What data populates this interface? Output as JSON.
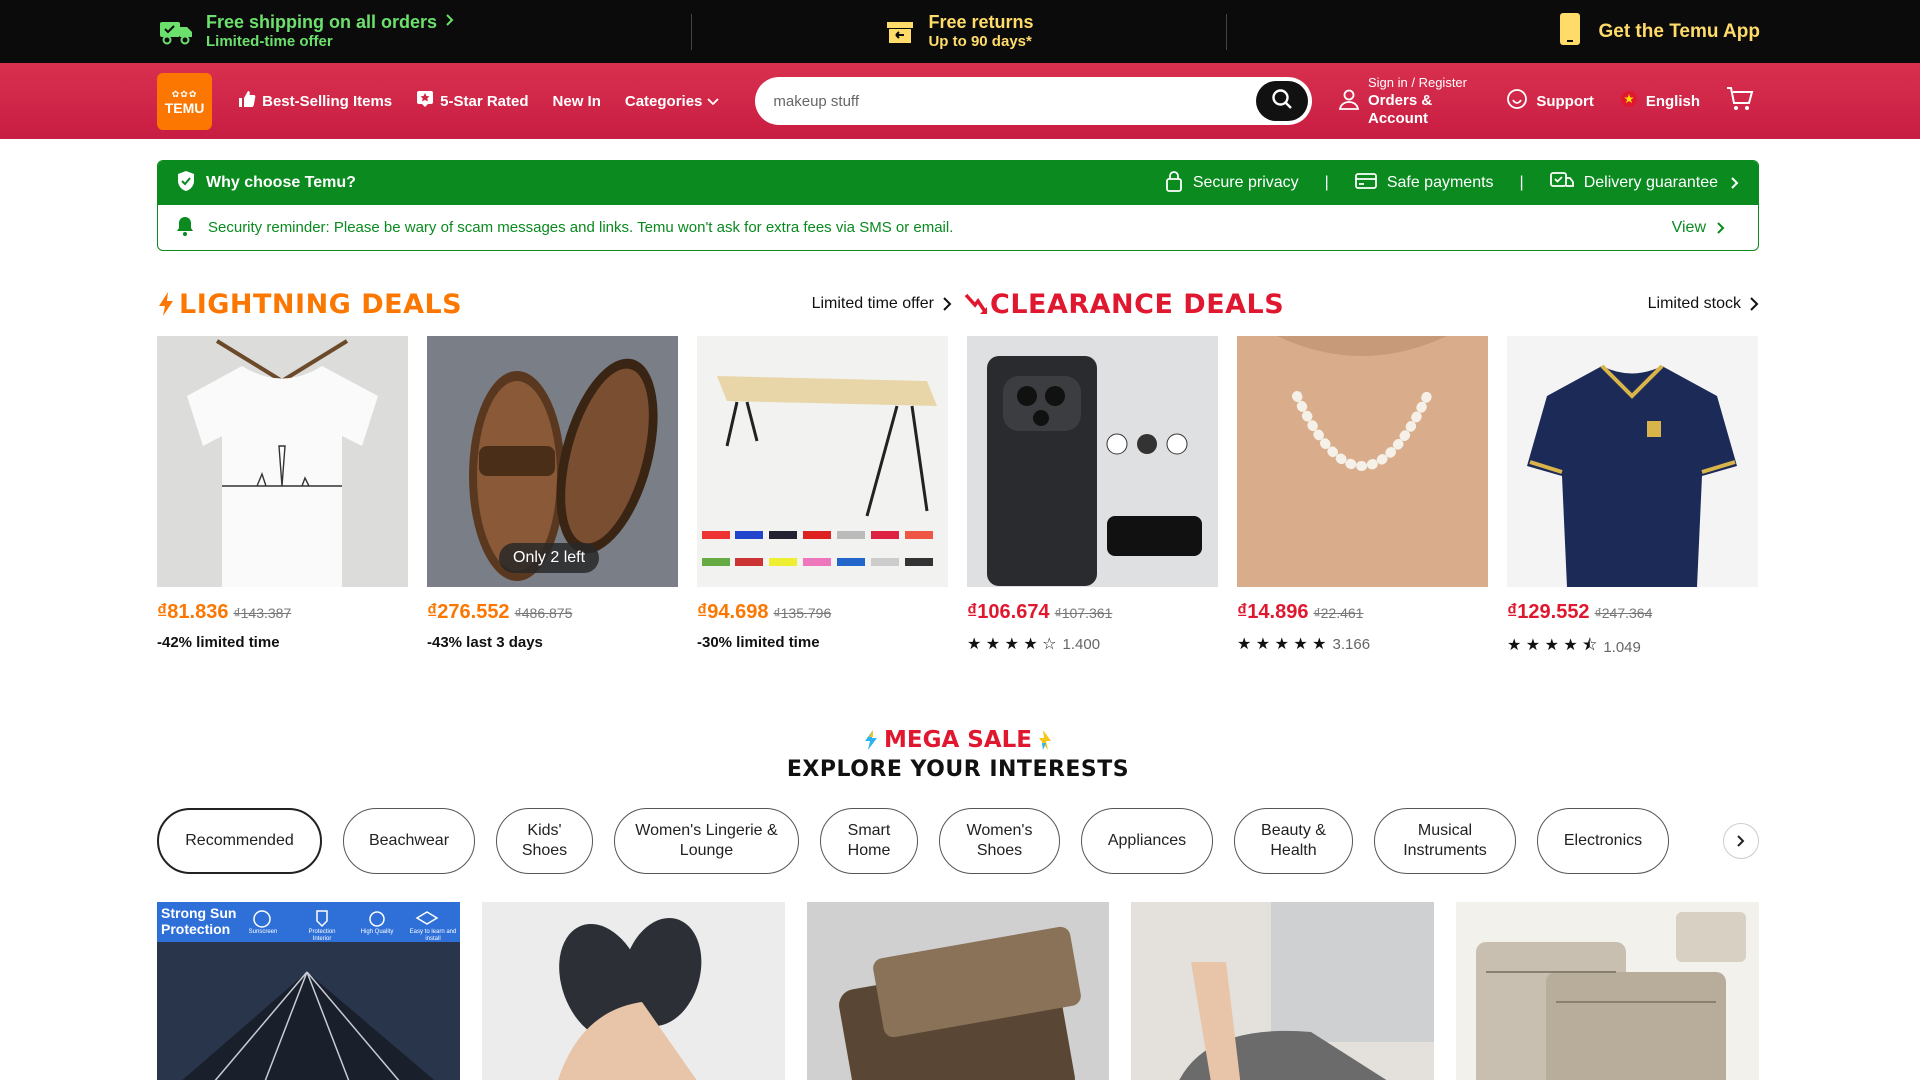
{
  "topbar": {
    "shipping_title": "Free shipping on all orders",
    "shipping_sub": "Limited-time offer",
    "returns_title": "Free returns",
    "returns_sub": "Up to 90 days*",
    "app_label": "Get the Temu App"
  },
  "header": {
    "logo_text": "TEMU",
    "nav": {
      "best_selling": "Best-Selling Items",
      "five_star": "5-Star Rated",
      "new_in": "New In",
      "categories": "Categories"
    },
    "search_value": "makeup stuff",
    "account_line1": "Sign in / Register",
    "account_line2": "Orders & Account",
    "support": "Support",
    "language": "English"
  },
  "why": {
    "title": "Why choose Temu?",
    "features": [
      "Secure privacy",
      "Safe payments",
      "Delivery guarantee"
    ],
    "reminder": "Security reminder: Please be wary of scam messages and links. Temu won't ask for extra fees via SMS or email.",
    "view": "View"
  },
  "lightning": {
    "title": "LIGHTNING DEALS",
    "link": "Limited time offer",
    "products": [
      {
        "price": "₫81.836",
        "old": "₫143.387",
        "note": "-42% limited time"
      },
      {
        "price": "₫276.552",
        "old": "₫486.875",
        "note": "-43% last 3 days",
        "badge": "Only 2 left"
      },
      {
        "price": "₫94.698",
        "old": "₫135.796",
        "note": "-30% limited time"
      }
    ]
  },
  "clearance": {
    "title": "CLEARANCE DEALS",
    "link": "Limited stock",
    "products": [
      {
        "price": "₫106.674",
        "old": "₫107.361",
        "rating": 4.0,
        "count": "1.400"
      },
      {
        "price": "₫14.896",
        "old": "₫22.461",
        "rating": 5.0,
        "count": "3.166"
      },
      {
        "price": "₫129.552",
        "old": "₫247.364",
        "rating": 4.5,
        "count": "1.049"
      }
    ]
  },
  "mega": {
    "sale": "MEGA SALE",
    "explore": "EXPLORE YOUR INTERESTS"
  },
  "chips": [
    "Recommended",
    "Beachwear",
    "Kids' Shoes",
    "Women's Lingerie & Lounge",
    "Smart Home",
    "Women's Shoes",
    "Appliances",
    "Beauty & Health",
    "Musical Instruments",
    "Electronics"
  ],
  "grid_banner": {
    "headline": "Strong Sun Protection",
    "tags": [
      "Sunscreen",
      "Protection Interior",
      "High Quality",
      "Easy to learn and install"
    ]
  },
  "colors": {
    "header_red": "#d02644",
    "orange": "#fb7701",
    "deal_red": "#e0182f",
    "trust_green": "#0a8a1f"
  }
}
